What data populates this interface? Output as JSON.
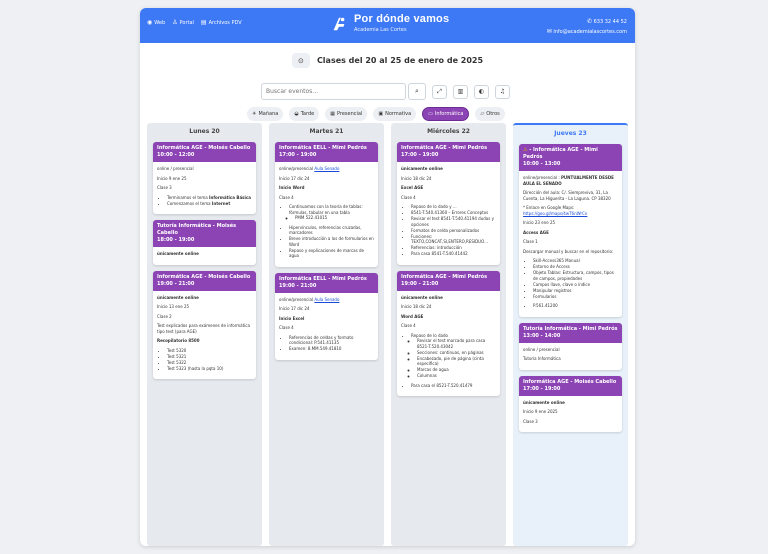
{
  "topnav": {
    "web": "Web",
    "portal": "Portal",
    "archivos": "Archivos PDV"
  },
  "brand": {
    "title": "Por dónde vamos",
    "subtitle": "Academia Las Cortes"
  },
  "contact": {
    "phone": "633 32 44 52",
    "email": "info@academialascortes.com"
  },
  "week": {
    "title": "Clases del 20 al 25 de enero de 2025"
  },
  "search": {
    "placeholder": "Buscar eventos..."
  },
  "filters": {
    "manana": "Mañana",
    "tarde": "Tarde",
    "presencial": "Presencial",
    "normativa": "Normativa",
    "informatica": "Informática",
    "otros": "Otros"
  },
  "days": {
    "lunes": "Lunes 20",
    "martes": "Martes 21",
    "miercoles": "Miércoles 22",
    "jueves": "Jueves 23"
  },
  "lunes": {
    "c1": {
      "title": "Informática AGE - Moisés Cabello",
      "time": "10:00 - 12:00",
      "mode": "online / presencial",
      "start": "Inicio 9 ene 25",
      "clase": "Clase 3",
      "li1a": "Terminamos el tema ",
      "li1b": "Informática Básica",
      "li2a": "Comenzamos el tema ",
      "li2b": "Internet"
    },
    "c2": {
      "title": "Tutoría Informática - Moisés Cabello",
      "time": "18:00 - 19:00",
      "mode": "únicamente online"
    },
    "c3": {
      "title": "Informática AGE - Moisés Cabello",
      "time": "19:00 - 21:00",
      "mode": "únicamente online",
      "start": "Inicio 13 ene 25",
      "clase": "Clase 2",
      "desc": "Test explicados para exámenes de informática tipo test (para AGE)",
      "recop": "Recopilatorio 8500",
      "t1": "Test 5320",
      "t2": "Test 5321",
      "t3": "Test 5322",
      "t4": "Test 5323 (hasta la pqta 10)"
    }
  },
  "martes": {
    "c1": {
      "title": "Informática EELL - Mimi Pedrós",
      "time": "17:00 - 19:00",
      "mode": "online/presencial ",
      "link": "Aula Senado",
      "start": "Inicio 17 dic 24",
      "sub": "Inicio Word",
      "clase": "Clase 4",
      "li1": "Continuamos con la teoría de tablas: fórmulas, tabular en una tabla",
      "li1a": "PMM 522.41015",
      "li2": "Hipervínculos, referencias cruzadas, marcadores",
      "li3": "Breve introducción a los de formularios en Word",
      "li4": "Repaso y explicaciones de marcas de agua"
    },
    "c2": {
      "title": "Informática EELL - Mimi Pedrós",
      "time": "19:00 - 21:00",
      "mode": "online/presencial ",
      "link": "Aula Senado",
      "start": "Inicio 17 dic 24",
      "sub": "Inicio Excel",
      "clase": "Clase 4",
      "li1": "Referencias de celdas y formato condicional: P.541.41135",
      "li2": "Examen: 8.MM.549.41810"
    }
  },
  "miercoles": {
    "c1": {
      "title": "Informática AGE - Mimi Pedrós",
      "time": "17:00 - 19:00",
      "mode": "únicamente online",
      "start": "Inicio 18 dic 24",
      "sub": "Excel AGE",
      "clase": "Clase 4",
      "li1": "Repaso de lo dado y ...",
      "li2": "8541-T.540.41360 – Errores Conceptos",
      "li3": "Revisar el test 8541-T.540.41194 dudas y opciones",
      "li4": "Formatos de celda personalizados",
      "li5": "Funciones: TEXTO,CONCAT,SI,ENTERO,RESIDUO...",
      "li6": "Referencias: introducción",
      "li7": "Para casa 8541-T.540.41442"
    },
    "c2": {
      "title": "Informática AGE - Mimi Pedrós",
      "time": "19:00 - 21:00",
      "mode": "únicamente online",
      "start": "Inicio 18 dic 24",
      "sub": "Word AGE",
      "clase": "Clase 4",
      "li1": "Repaso de lo dado",
      "li1a": "Revisar el test marcado para casa 8521-T.520.43042",
      "li1b": "Secciones: continuas, en páginas",
      "li1c": "Encabezado, pie de página (cinta específica)",
      "li1d": "Marcas de agua",
      "li1e": "Columnas",
      "li2": "Para casa el 8521-T.520.41479"
    }
  },
  "jueves": {
    "c1": {
      "title": "- Informática AGE - Mimi Pedrós",
      "time": "10:00 - 13:00",
      "mode": "online/presencial : ",
      "modeb": "PUNTUALMENTE DESDE AULA EL SENADO",
      "addr": "Dirección del aula: C/. Siempreviva, 31, La Cuenta, La Higuerita - La Laguna. CP 38320",
      "maps": "* Enlace en Google Maps:",
      "mapsurl": "https://goo.gl/maps/4wT6nWrCn",
      "start": "Inicio 23 ene 25",
      "sub": "Access AGE",
      "clase": "Clase 1",
      "desc": "Descargar manual y buscar en el repositorio:",
      "li1": "Skill-Access365 Manual",
      "li2": "Entorno de Access",
      "li3": "Objeto Tablas: Estructura, campos, tipos de campos, propiedades",
      "li4": "Campos llave, clave o índice",
      "li5": "Manipular registros",
      "li6": "Formularios",
      "li7": "P.561.41200"
    },
    "c2": {
      "title": "Tutoría Informática - Mimi Pedrós",
      "time": "13:00 - 14:00",
      "mode": "online / presencial",
      "desc": "Tutoría Informática"
    },
    "c3": {
      "title": "Informática AGE - Moisés Cabello",
      "time": "17:00 - 19:00",
      "mode": "únicamente online",
      "start": "Inicio 9 ene 2025",
      "clase": "Clase 3"
    }
  }
}
